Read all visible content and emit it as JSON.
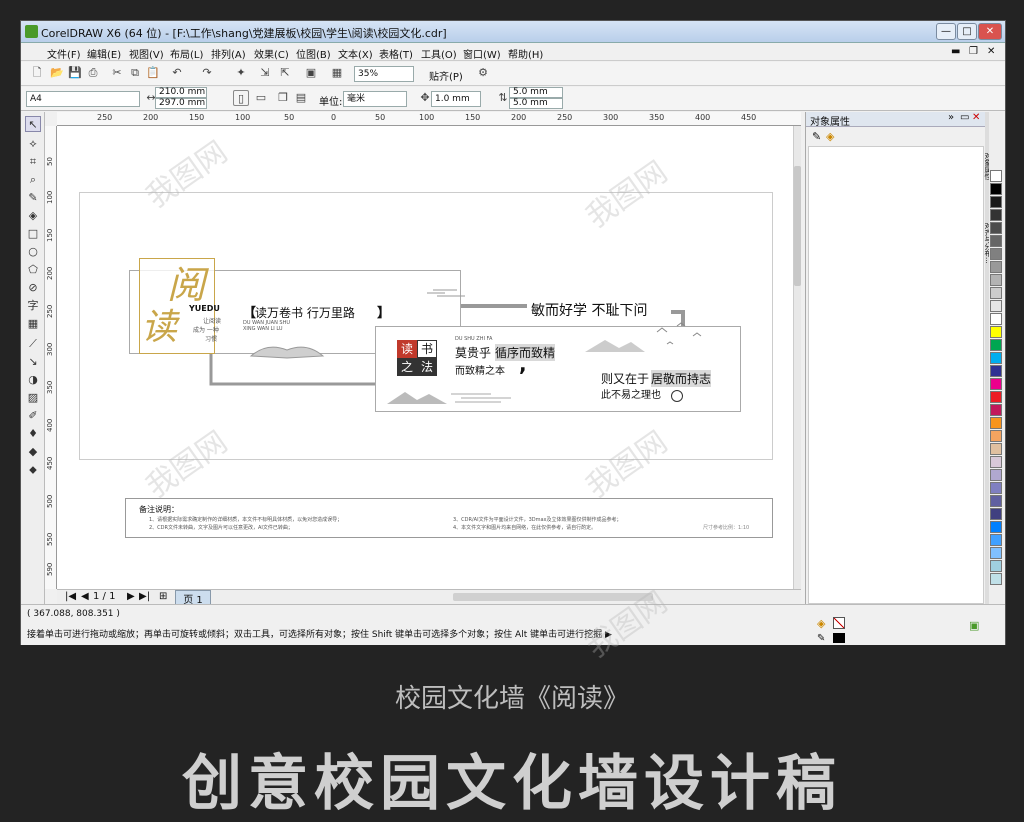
{
  "window": {
    "title": "CorelDRAW X6 (64 位) - [F:\\工作\\shang\\党建展板\\校园\\学生\\阅读\\校园文化.cdr]",
    "minimize": "—",
    "maximize": "□",
    "close": "✕"
  },
  "menu": [
    "文件(F)",
    "编辑(E)",
    "视图(V)",
    "布局(L)",
    "排列(A)",
    "效果(C)",
    "位图(B)",
    "文本(X)",
    "表格(T)",
    "工具(O)",
    "窗口(W)",
    "帮助(H)"
  ],
  "toolbar": {
    "zoom": "35%",
    "snap": "贴齐(P)"
  },
  "propbar": {
    "page_size": "A4",
    "width": "210.0 mm",
    "height": "297.0 mm",
    "unit_label": "单位:",
    "unit": "毫米",
    "nudge": "1.0 mm",
    "dup_x": "5.0 mm",
    "dup_y": "5.0 mm"
  },
  "ruler": {
    "h": [
      "250",
      "200",
      "150",
      "100",
      "50",
      "0",
      "50",
      "100",
      "150",
      "200",
      "250",
      "300",
      "350",
      "400",
      "450"
    ],
    "v": [
      "50",
      "100",
      "150",
      "200",
      "250",
      "300",
      "350",
      "400",
      "450",
      "500",
      "550",
      "590"
    ]
  },
  "canvas": {
    "logo_char1": "阅",
    "logo_char2": "读",
    "yuedu": "YUEDU",
    "small1": "让阅读",
    "small2": "成为 一种",
    "small3": "习惯",
    "title1": "读万卷书  行万里路",
    "pinyin1": "DU WAN JUAN SHU",
    "pinyin2": "XING WAN LI LU",
    "motto": "敏而好学  不耻下问",
    "dushu_pinyin": "DU SHU ZHI FA",
    "seal": [
      "读",
      "书",
      "之",
      "法"
    ],
    "line1a": "莫贵乎",
    "line1b": "循序而致精",
    "line2": "而致精之本",
    "comma": ",",
    "line3a": "则又在于",
    "line3b": "居敬而持志",
    "line4": "此不易之理也",
    "notes_title": "备注说明：",
    "notes": [
      "1、请根据实际需求确定制作的详细材质，本文件不标明具体材质，以免对您造成误导；",
      "2、CDR文件未转曲，文字及图片可以任意更改，AI文件已转曲；",
      "3、CDR/AI文件为平面设计文件，3Dmax及立体效果图仅供制作成品参考；",
      "4、本文件文字和图片均来自网络，在此仅供参考，请自行酌定。"
    ],
    "scale_note": "尺寸参考比例：1:10"
  },
  "nav": {
    "pages": "1 / 1",
    "page_tab": "页 1"
  },
  "docker": {
    "title": "对象属性",
    "side1": "对象属性",
    "side2": "对齐与分布..."
  },
  "status": {
    "coords": "( 367.088, 808.351 )",
    "hint": "接着单击可进行拖动或缩放；再单击可旋转或倾斜；双击工具，可选择所有对象；按住 Shift 键单击可选择多个对象；按住 Alt 键单击可进行挖掘 ▶"
  },
  "palette_colors": [
    "#ffffff",
    "#000000",
    "#1a1a1a",
    "#333333",
    "#4d4d4d",
    "#666666",
    "#808080",
    "#999999",
    "#b3b3b3",
    "#cccccc",
    "#e6e6e6",
    "#ffffff",
    "#ffff00",
    "#00a651",
    "#00aeef",
    "#2e3192",
    "#ec008c",
    "#ed1c24",
    "#c2185b",
    "#f7941d",
    "#f4a460",
    "#e0c0a0",
    "#d8c8d8",
    "#b0a8d0",
    "#8080c0",
    "#6060a0",
    "#404080",
    "#0080ff",
    "#40a0ff",
    "#80c0ff",
    "#a0d0e0",
    "#c0e0e8"
  ],
  "bottom_swatches": [
    "#666666",
    "#333333",
    "#000000",
    "#4d4d4d",
    "#999999",
    "#b3b3b3",
    "#cccccc",
    "#e6e6e6",
    "#808080",
    "#1ab0d0",
    "#00a651"
  ],
  "caption": "校园文化墙《阅读》",
  "caption2": "创意校园文化墙设计稿"
}
